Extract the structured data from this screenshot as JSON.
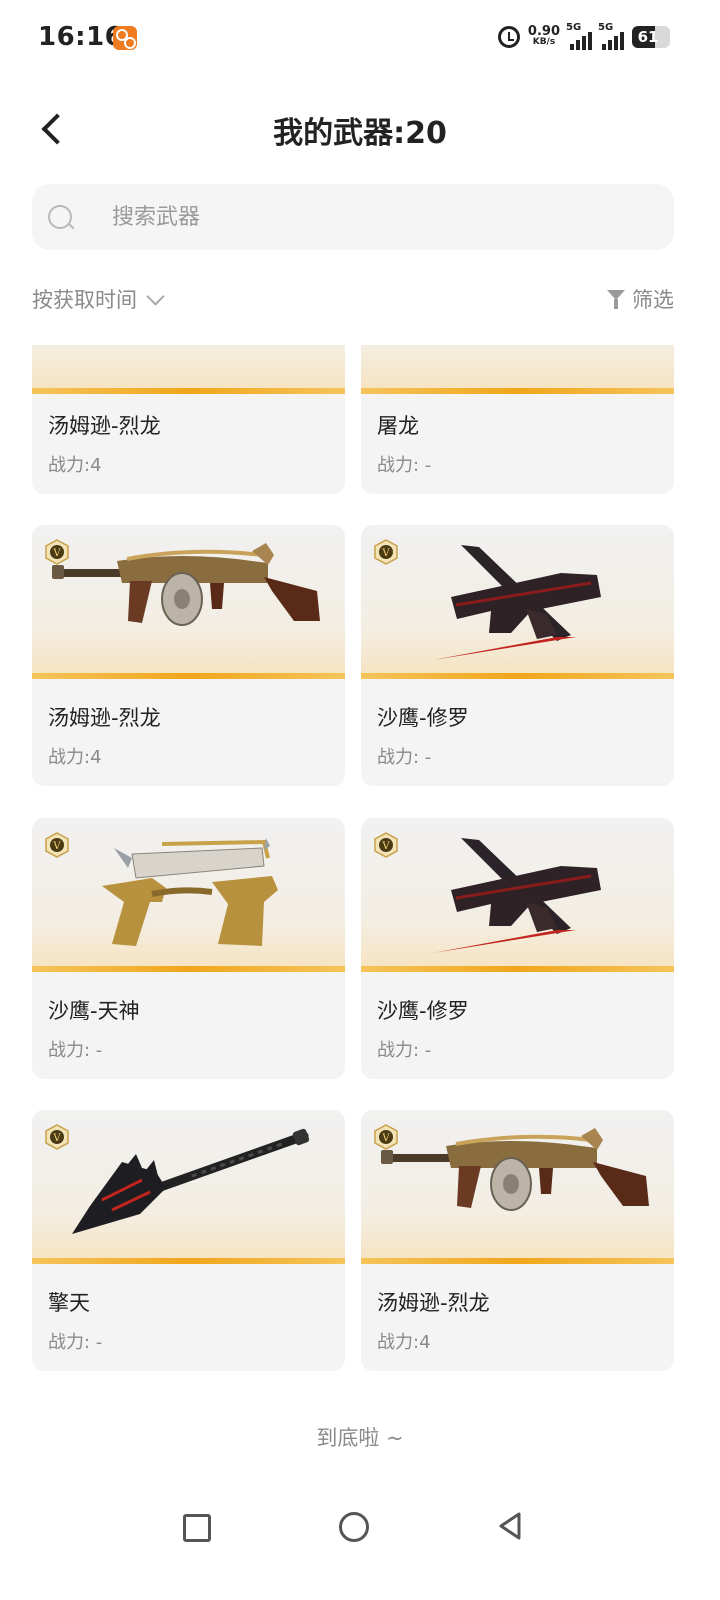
{
  "status_bar": {
    "time": "16:16",
    "net_speed_value": "0.90",
    "net_speed_unit": "KB/s",
    "sim1_label": "5G",
    "sim2_label": "5G",
    "battery_level": "61"
  },
  "header": {
    "title": "我的武器:20"
  },
  "search": {
    "placeholder": "搜索武器"
  },
  "toolbar": {
    "sort_label": "按获取时间",
    "filter_label": "筛选"
  },
  "weapons": [
    {
      "name": "汤姆逊-烈龙",
      "power": "战力:4",
      "icon": "thompson-dragon-rifle"
    },
    {
      "name": "屠龙",
      "power": "战力: -",
      "icon": "dragon-slayer"
    },
    {
      "name": "汤姆逊-烈龙",
      "power": "战力:4",
      "icon": "thompson-dragon-rifle"
    },
    {
      "name": "沙鹰-修罗",
      "power": "战力: -",
      "icon": "desert-eagle-asura"
    },
    {
      "name": "沙鹰-天神",
      "power": "战力: -",
      "icon": "desert-eagle-deity"
    },
    {
      "name": "沙鹰-修罗",
      "power": "战力: -",
      "icon": "desert-eagle-asura"
    },
    {
      "name": "擎天",
      "power": "战力: -",
      "icon": "shovel-qingtian"
    },
    {
      "name": "汤姆逊-烈龙",
      "power": "战力:4",
      "icon": "thompson-dragon-rifle"
    }
  ],
  "footer": {
    "end_text": "到底啦 ~"
  },
  "colors": {
    "accent_orange": "#f0a61b",
    "card_bg": "#f4f4f4",
    "muted_text": "#8a8a8a"
  }
}
